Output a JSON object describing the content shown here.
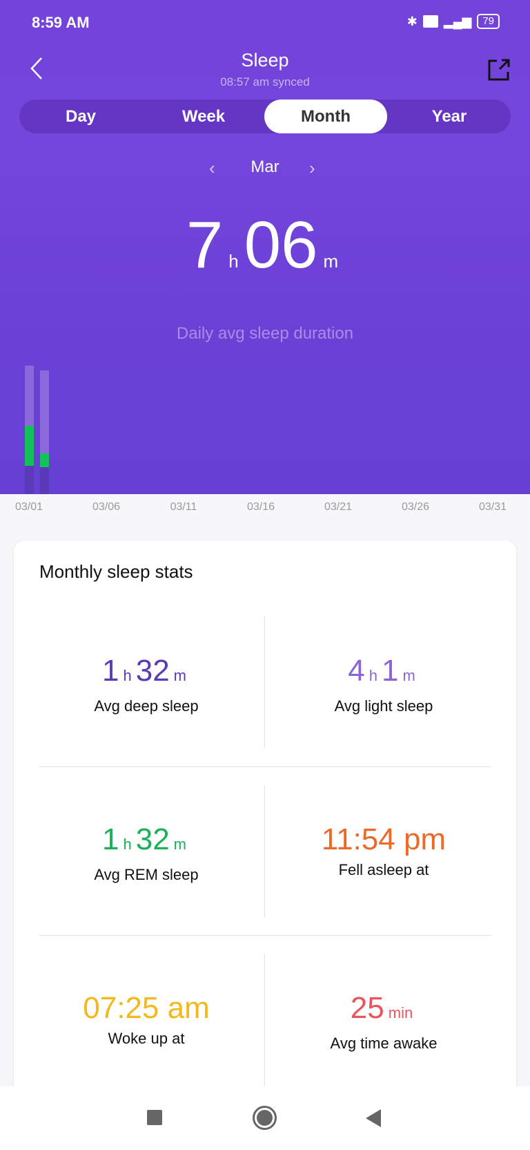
{
  "status_bar": {
    "time": "8:59 AM",
    "battery": "79",
    "icons": [
      "bluetooth-icon",
      "volte-icon",
      "signal-icon",
      "battery-icon"
    ]
  },
  "header": {
    "title": "Sleep",
    "subtitle": "08:57 am synced",
    "back_icon": "chevron-left-icon",
    "share_icon": "share-icon"
  },
  "tabs": [
    {
      "label": "Day"
    },
    {
      "label": "Week"
    },
    {
      "label": "Month",
      "active": true
    },
    {
      "label": "Year"
    }
  ],
  "period": {
    "label": "Mar"
  },
  "summary": {
    "hours": "7",
    "hours_unit": "h",
    "minutes": "06",
    "minutes_unit": "m",
    "caption": "Daily avg sleep duration"
  },
  "chart_data": {
    "type": "bar",
    "stacked": true,
    "x": [
      "03/01",
      "03/02"
    ],
    "x_ticks": [
      "03/01",
      "03/06",
      "03/11",
      "03/16",
      "03/21",
      "03/26",
      "03/31"
    ],
    "xlim": [
      "03/01",
      "03/31"
    ],
    "series": [
      {
        "key": "deep",
        "values": [
          1.6,
          1.5
        ],
        "color": "#5a3ab8"
      },
      {
        "key": "rem",
        "values": [
          2.25,
          0.8
        ],
        "color": "#14c15a"
      },
      {
        "key": "light",
        "values": [
          3.4,
          4.65
        ],
        "color": "#8b69dc"
      }
    ],
    "unit": "hours",
    "grid": false
  },
  "stats": {
    "title": "Monthly sleep stats",
    "items": [
      {
        "parts": [
          [
            "1",
            "h"
          ],
          [
            "32",
            "m"
          ]
        ],
        "label": "Avg deep sleep",
        "color": "#5b3bb5"
      },
      {
        "parts": [
          [
            "4",
            "h"
          ],
          [
            "1",
            "m"
          ]
        ],
        "label": "Avg light sleep",
        "color": "#8a64d8"
      },
      {
        "parts": [
          [
            "1",
            "h"
          ],
          [
            "32",
            "m"
          ]
        ],
        "label": "Avg REM sleep",
        "color": "#19b25a"
      },
      {
        "parts": [
          [
            "11:54 pm",
            ""
          ]
        ],
        "label": "Fell asleep at",
        "color": "#ec6a27"
      },
      {
        "parts": [
          [
            "07:25 am",
            ""
          ]
        ],
        "label": "Woke up at",
        "color": "#f3b91a"
      },
      {
        "parts": [
          [
            "25",
            "min"
          ]
        ],
        "label": "Avg time awake",
        "color": "#e9545e"
      }
    ]
  },
  "nav": {
    "icons": [
      "recents-square-icon",
      "home-circle-icon",
      "back-triangle-icon"
    ]
  }
}
